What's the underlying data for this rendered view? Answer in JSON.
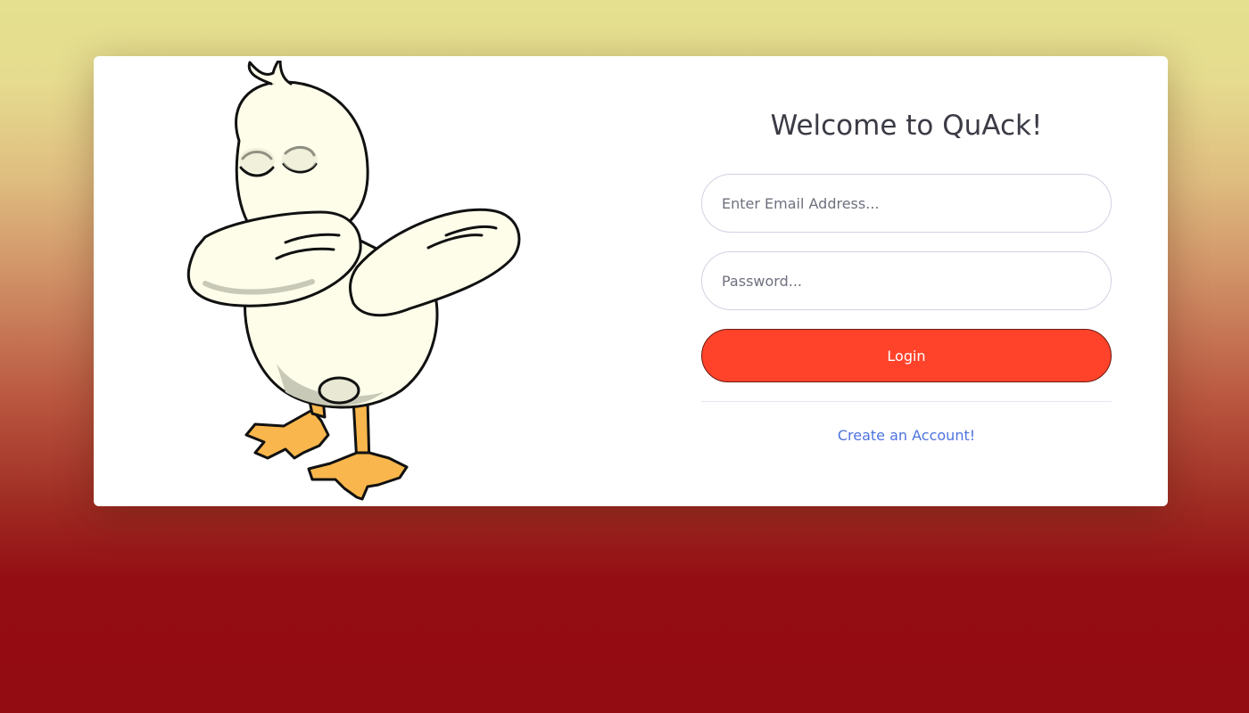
{
  "login": {
    "title": "Welcome to QuAck!",
    "email_placeholder": "Enter Email Address...",
    "password_placeholder": "Password...",
    "login_label": "Login",
    "create_account_label": "Create an Account!"
  },
  "illustration": {
    "icon": "dabbing-duck-icon"
  },
  "colors": {
    "login_button": "#ff432b",
    "link": "#4e73df",
    "title": "#3a3b45",
    "input_border": "#d1d3e2",
    "background_top": "#e4e08f",
    "background_bottom": "#930c12"
  }
}
